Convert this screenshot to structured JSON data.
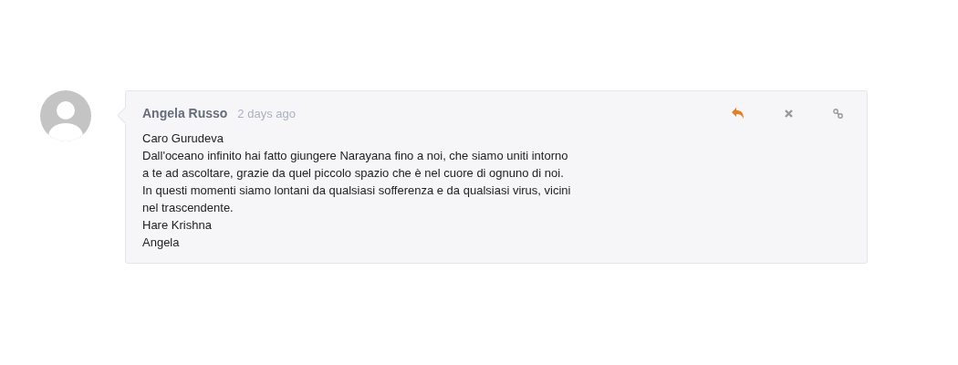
{
  "comment": {
    "author": "Angela Russo",
    "time": "2 days ago",
    "lines": [
      "Caro Gurudeva",
      "Dall'oceano infinito hai fatto giungere Narayana fino a noi, che siamo uniti intorno",
      "a te ad ascoltare, grazie da quel piccolo spazio che è nel cuore di ognuno di noi.",
      "In questi momenti siamo lontani da qualsiasi sofferenza e da qualsiasi virus, vicini",
      "nel trascendente.",
      "Hare Krishna",
      "Angela"
    ]
  }
}
